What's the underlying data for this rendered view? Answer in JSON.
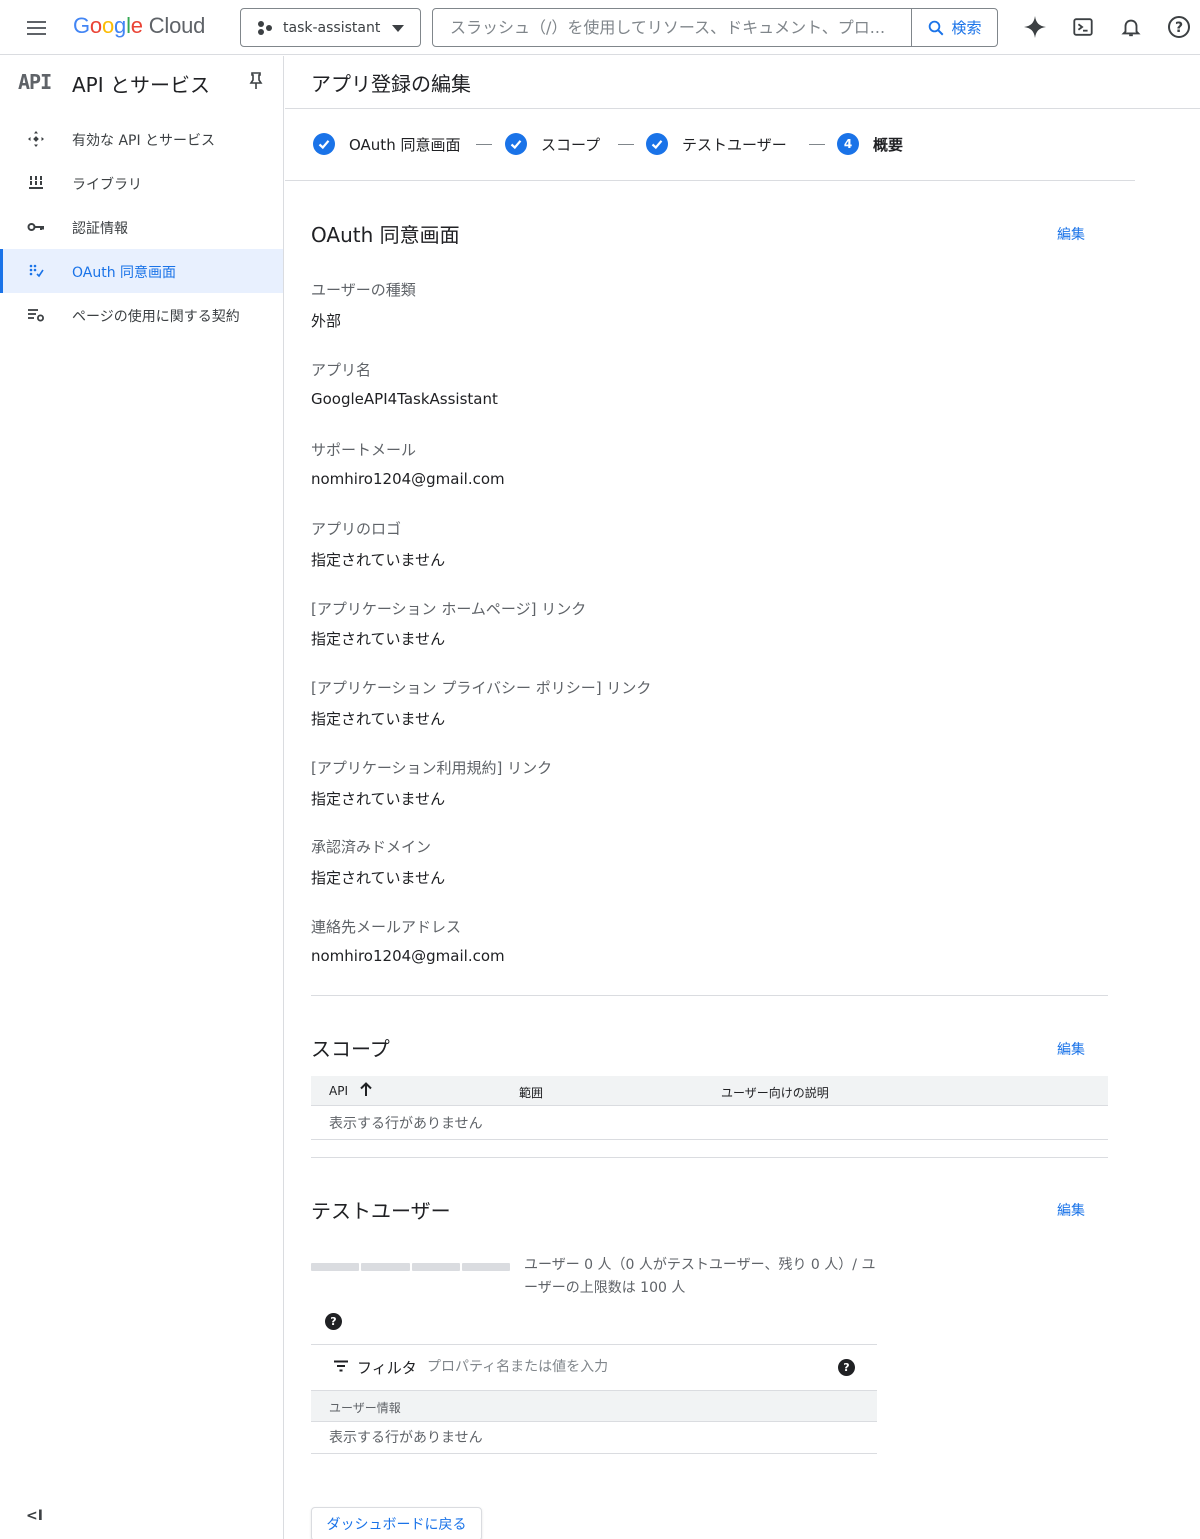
{
  "header": {
    "menu_icon": "hamburger-menu-icon",
    "logo": {
      "google": "Google",
      "cloud": "Cloud"
    },
    "project": "task-assistant",
    "search": {
      "placeholder": "スラッシュ（/）を使用してリソース、ドキュメント、プロ...",
      "button_label": "検索"
    },
    "icons": [
      "gemini-sparkle-icon",
      "cloud-shell-icon",
      "notifications-bell-icon",
      "help-icon"
    ]
  },
  "sidebar": {
    "badge": "API",
    "title": "API とサービス",
    "items": [
      {
        "label": "有効な API とサービス",
        "icon": "enabled-apis-icon",
        "active": false
      },
      {
        "label": "ライブラリ",
        "icon": "library-icon",
        "active": false
      },
      {
        "label": "認証情報",
        "icon": "key-icon",
        "active": false
      },
      {
        "label": "OAuth 同意画面",
        "icon": "oauth-consent-icon",
        "active": true
      },
      {
        "label": "ページの使用に関する契約",
        "icon": "page-usage-agreements-icon",
        "active": false
      }
    ],
    "collapse_label": "<I"
  },
  "main": {
    "page_title": "アプリ登録の編集",
    "steps": [
      {
        "label": "OAuth 同意画面",
        "state": "done"
      },
      {
        "label": "スコープ",
        "state": "done"
      },
      {
        "label": "テストユーザー",
        "state": "done"
      },
      {
        "label": "概要",
        "number": "4",
        "state": "current"
      }
    ],
    "oauth_section": {
      "title": "OAuth 同意画面",
      "edit_label": "編集",
      "fields": [
        {
          "label": "ユーザーの種類",
          "value": "外部"
        },
        {
          "label": "アプリ名",
          "value": "GoogleAPI4TaskAssistant"
        },
        {
          "label": "サポートメール",
          "value": "nomhiro1204@gmail.com"
        },
        {
          "label": "アプリのロゴ",
          "value": "指定されていません"
        },
        {
          "label": "[アプリケーション ホームページ] リンク",
          "value": "指定されていません"
        },
        {
          "label": "[アプリケーション プライバシー ポリシー] リンク",
          "value": "指定されていません"
        },
        {
          "label": "[アプリケーション利用規約] リンク",
          "value": "指定されていません"
        },
        {
          "label": "承認済みドメイン",
          "value": "指定されていません"
        },
        {
          "label": "連絡先メールアドレス",
          "value": "nomhiro1204@gmail.com"
        }
      ]
    },
    "scope_section": {
      "title": "スコープ",
      "edit_label": "編集",
      "columns": [
        "API",
        "範囲",
        "ユーザー向けの説明"
      ],
      "empty_text": "表示する行がありません"
    },
    "test_users_section": {
      "title": "テストユーザー",
      "edit_label": "編集",
      "usage_fraction": 0,
      "count_text": "ユーザー 0 人（0 人がテストユーザー、残り 0 人）/ ユーザーの上限数は 100 人",
      "filter_label": "フィルタ",
      "filter_placeholder": "プロパティ名または値を入力",
      "column": "ユーザー情報",
      "empty_text": "表示する行がありません"
    },
    "back_button": "ダッシュボードに戻る"
  },
  "colors": {
    "accent": "#1a73e8",
    "active_bg": "#e8f0fe",
    "divider": "#dadce0"
  }
}
